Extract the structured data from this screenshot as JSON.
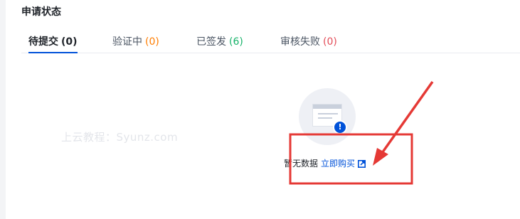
{
  "page": {
    "title": "申请状态"
  },
  "tabs": [
    {
      "label": "待提交",
      "count": "(0)",
      "active": true
    },
    {
      "label": "验证中",
      "count": "(0)",
      "active": false
    },
    {
      "label": "已签发",
      "count": "(6)",
      "active": false
    },
    {
      "label": "审核失败",
      "count": "(0)",
      "active": false
    }
  ],
  "empty_state": {
    "text": "暂无数据",
    "link_label": "立即购买",
    "illustration_icon": "document-alert-icon",
    "link_icon": "external-link-icon"
  },
  "watermark": "上云教程：Syunz.com",
  "colors": {
    "accent": "#0052d9",
    "count_verifying": "#ff7d00",
    "count_issued": "#17b26a",
    "count_failed": "#e34d59",
    "annotation": "#e53935"
  }
}
